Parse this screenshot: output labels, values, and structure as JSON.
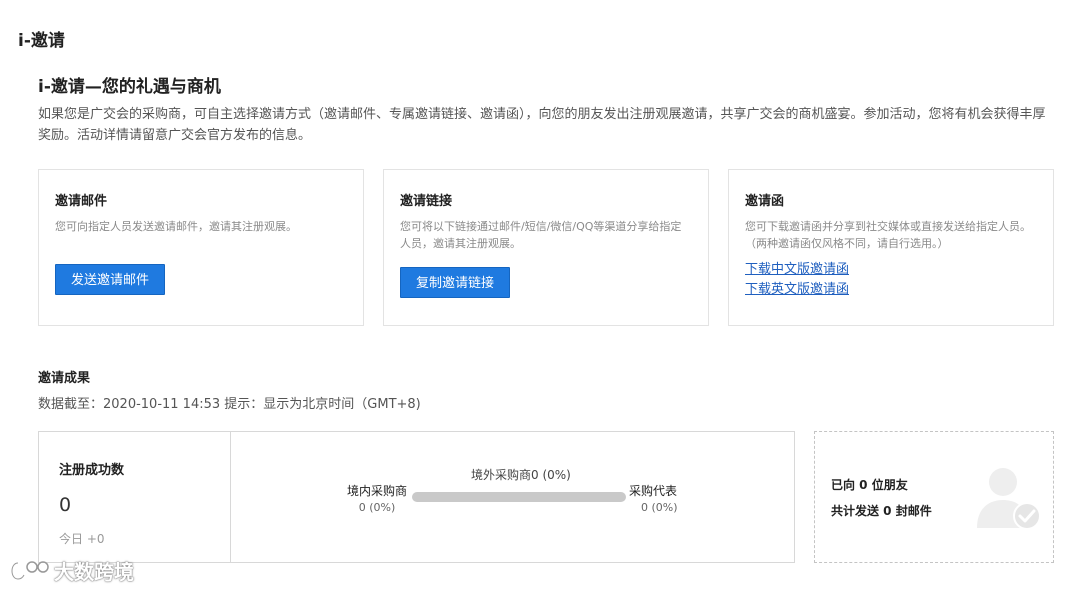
{
  "page": {
    "title": "i-邀请"
  },
  "intro": {
    "heading": "i-邀请—您的礼遇与商机",
    "text": "如果您是广交会的采购商，可自主选择邀请方式（邀请邮件、专属邀请链接、邀请函），向您的朋友发出注册观展邀请，共享广交会的商机盛宴。参加活动，您将有机会获得丰厚奖励。活动详情请留意广交会官方发布的信息。"
  },
  "cards": {
    "email": {
      "title": "邀请邮件",
      "desc": "您可向指定人员发送邀请邮件，邀请其注册观展。",
      "button": "发送邀请邮件"
    },
    "link": {
      "title": "邀请链接",
      "desc": "您可将以下链接通过邮件/短信/微信/QQ等渠道分享给指定人员，邀请其注册观展。",
      "button": "复制邀请链接"
    },
    "letter": {
      "title": "邀请函",
      "desc": "您可下载邀请函并分享到社交媒体或直接发送给指定人员。（两种邀请函仅风格不同，请自行选用。）",
      "link_cn": "下载中文版邀请函",
      "link_en": "下载英文版邀请函"
    }
  },
  "results": {
    "title": "邀请成果",
    "note": "数据截至：2020-10-11 14:53 提示：显示为北京时间（GMT+8)",
    "registered": {
      "label": "注册成功数",
      "count": "0",
      "today": "今日 +0"
    },
    "chart": {
      "overseas": "境外采购商0 (0%)",
      "domestic_label": "境内采购商",
      "domestic_value": "0 (0%)",
      "rep_label": "采购代表",
      "rep_value": "0 (0%)"
    },
    "friends": {
      "line1": "已向 0 位朋友",
      "line2": "共计发送 0 封邮件"
    }
  },
  "watermark": {
    "text": "大数跨境"
  },
  "colors": {
    "primary": "#1f7ae0",
    "link": "#1f5fbf",
    "bar": "#c9c9c9"
  }
}
